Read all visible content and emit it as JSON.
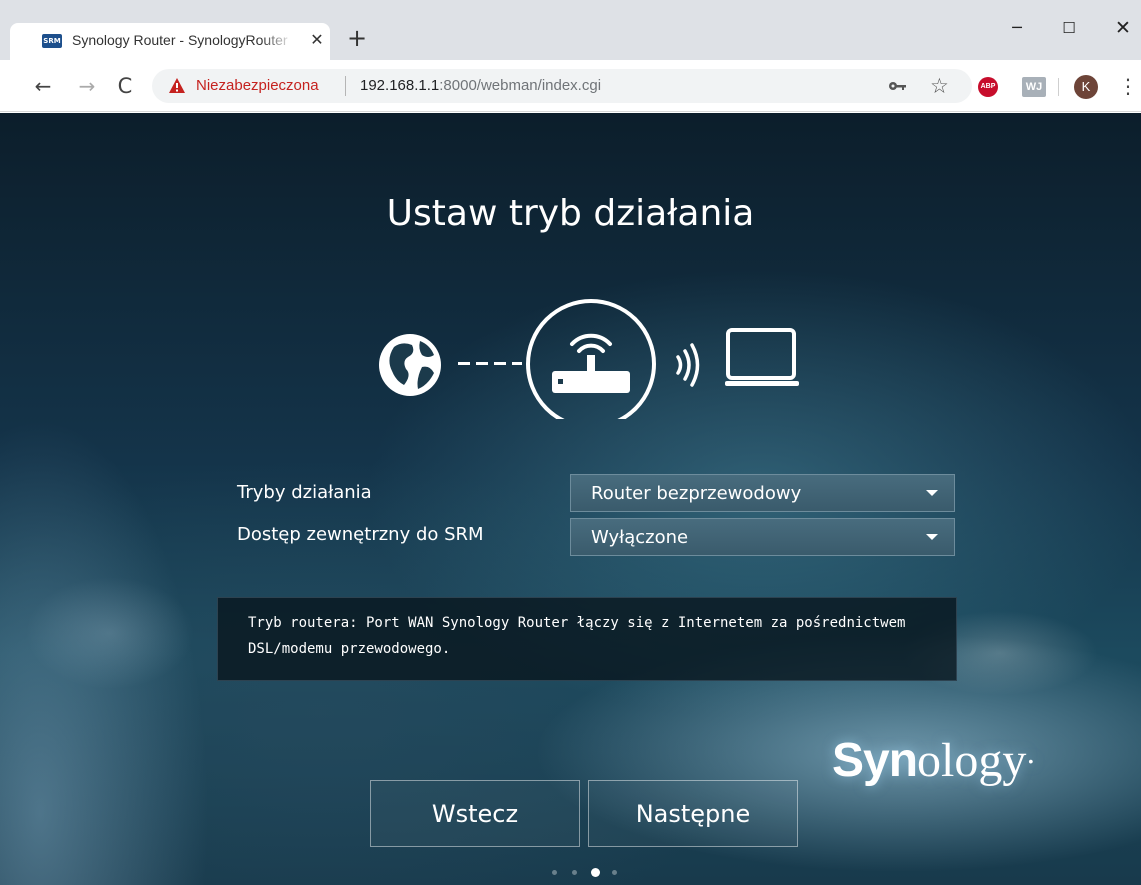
{
  "browser": {
    "tab_title": "Synology Router - SynologyRouter",
    "tab_favicon": "SRM",
    "tab_close": "✕",
    "new_tab": "+",
    "window_controls": {
      "minimize": "─",
      "maximize": "☐",
      "close": "✕"
    },
    "nav": {
      "back": "←",
      "forward": "→",
      "reload": "C"
    },
    "security_label": "Niezabezpieczona",
    "url_host": "192.168.1.1",
    "url_path": ":8000/webman/index.cgi",
    "bookmark_star": "☆",
    "extensions": {
      "abp": "ABP",
      "wj": "WJ"
    },
    "profile_initial": "K",
    "menu": "⋮"
  },
  "setup": {
    "title": "Ustaw tryb działania",
    "mode_label": "Tryby działania",
    "mode_value": "Router bezprzewodowy",
    "access_label": "Dostęp zewnętrzny do SRM",
    "access_value": "Wyłączone",
    "info_text": "Tryb routera: Port WAN Synology Router łączy się z Internetem za pośrednictwem DSL/modemu przewodowego.",
    "back_button": "Wstecz",
    "next_button": "Następne",
    "step_current": 3,
    "step_total": 4
  },
  "brand": {
    "part1": "Syn",
    "part2": "ology",
    "mark": "•"
  },
  "icons": {
    "globe": "globe-icon",
    "router": "router-icon",
    "wifi": "wireless-waves-icon",
    "laptop": "laptop-icon",
    "warning": "warning-icon",
    "key": "key-icon"
  },
  "colors": {
    "insecure_red": "#c5221f",
    "select_bg": "#3f6374",
    "abp_red": "#c70d2c",
    "avatar_brown": "#6d4438"
  }
}
